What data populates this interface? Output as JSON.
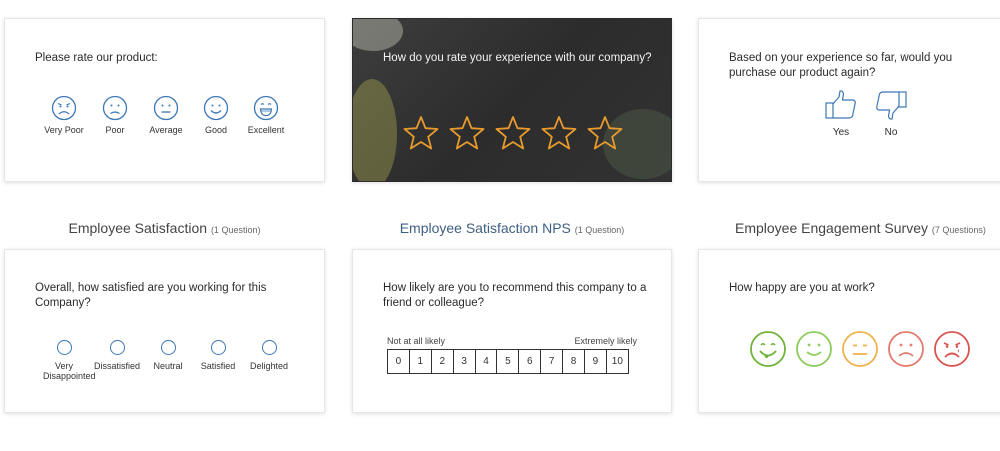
{
  "card1": {
    "question": "Please rate our product:",
    "options": [
      {
        "label": "Very Poor",
        "icon": "very-poor-face-icon"
      },
      {
        "label": "Poor",
        "icon": "poor-face-icon"
      },
      {
        "label": "Average",
        "icon": "average-face-icon"
      },
      {
        "label": "Good",
        "icon": "good-face-icon"
      },
      {
        "label": "Excellent",
        "icon": "excellent-face-icon"
      }
    ],
    "accent": "#3b78b5"
  },
  "card2": {
    "question": "How do you rate your experience with our company?",
    "stars": 5,
    "star_color": "#e89a2c"
  },
  "card3": {
    "question": "Based on your experience so far, would you purchase our product again?",
    "yes_label": "Yes",
    "no_label": "No"
  },
  "sections": [
    {
      "title": "Employee Satisfaction",
      "count": "(1 Question)"
    },
    {
      "title": "Employee Satisfaction NPS",
      "count": "(1 Question)"
    },
    {
      "title": "Employee Engagement Survey",
      "count": "(7 Questions)"
    }
  ],
  "card4": {
    "question": "Overall, how satisfied are you working for this Company?",
    "options": [
      "Very Disappointed",
      "Dissatisfied",
      "Neutral",
      "Satisfied",
      "Delighted"
    ]
  },
  "card5": {
    "question": "How likely are you to recommend this company to a friend or colleague?",
    "low_label": "Not at all likely",
    "high_label": "Extremely likely",
    "scale": [
      "0",
      "1",
      "2",
      "3",
      "4",
      "5",
      "6",
      "7",
      "8",
      "9",
      "10"
    ]
  },
  "card6": {
    "question": "How happy are you at work?",
    "faces": [
      {
        "icon": "very-happy-face-icon",
        "color": "#6fb33a"
      },
      {
        "icon": "happy-face-icon",
        "color": "#8ccc5a"
      },
      {
        "icon": "neutral-face-icon",
        "color": "#f0b24a"
      },
      {
        "icon": "sad-face-icon",
        "color": "#e37a6e"
      },
      {
        "icon": "very-sad-face-icon",
        "color": "#d9534f"
      }
    ]
  }
}
